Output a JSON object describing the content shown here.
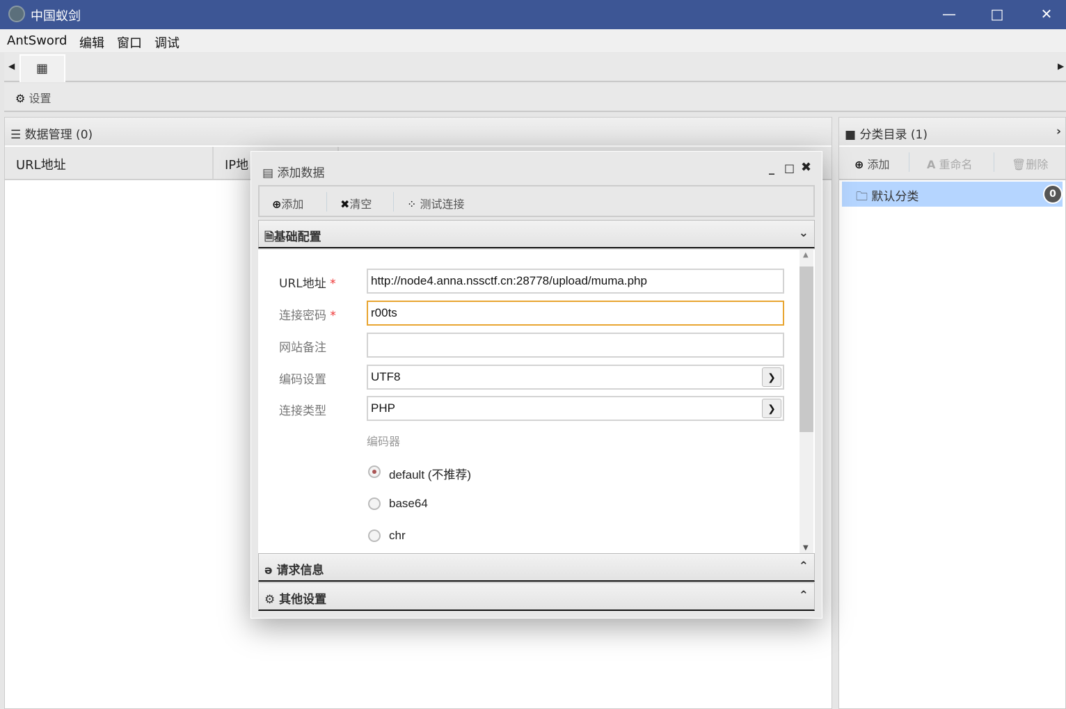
{
  "window": {
    "title": "中国蚁剑",
    "controls": [
      "minimize",
      "maximize",
      "close"
    ]
  },
  "menu": [
    "AntSword",
    "编辑",
    "窗口",
    "调试"
  ],
  "toolbar": {
    "settings": "设置"
  },
  "data_panel": {
    "title": "数据管理 (0)",
    "columns": [
      "URL地址",
      "IP地"
    ]
  },
  "category_panel": {
    "title": "分类目录 (1)",
    "add": "添加",
    "rename": "重命名",
    "delete": "删除",
    "items": [
      {
        "name": "默认分类",
        "count": "0"
      }
    ]
  },
  "dialog": {
    "title": "添加数据",
    "add": "添加",
    "clear": "清空",
    "test": "测试连接",
    "sections": {
      "basic": "基础配置",
      "request": "请求信息",
      "other": "其他设置"
    },
    "form": {
      "url_label": "URL地址",
      "url_value": "http://node4.anna.nssctf.cn:28778/upload/muma.php",
      "password_label": "连接密码",
      "password_value": "r00ts",
      "note_label": "网站备注",
      "note_value": "",
      "encoding_label": "编码设置",
      "encoding_value": "UTF8",
      "type_label": "连接类型",
      "type_value": "PHP",
      "encoder_label": "编码器",
      "encoders": [
        {
          "label": "default (不推荐)",
          "checked": true
        },
        {
          "label": "base64",
          "checked": false
        },
        {
          "label": "chr",
          "checked": false
        }
      ],
      "required_mark": "*"
    }
  },
  "colors": {
    "titlebar": "#3d5695",
    "selected": "#b5d5ff",
    "focus": "#e8a531"
  }
}
